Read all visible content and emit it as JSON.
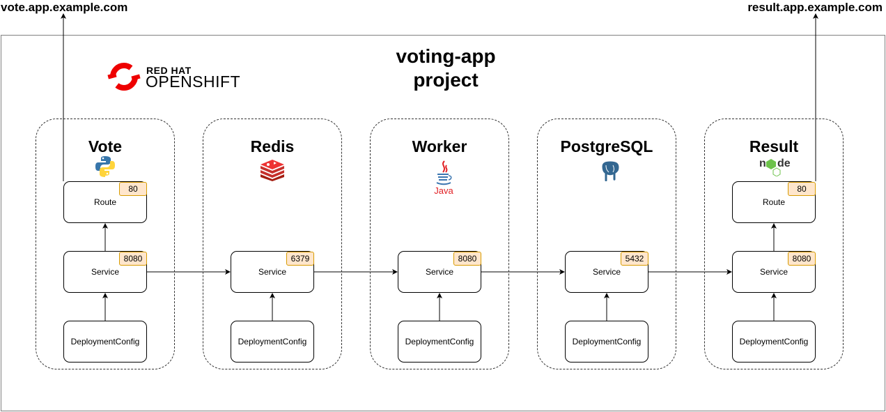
{
  "urls": {
    "vote": "vote.app.example.com",
    "result": "result.app.example.com"
  },
  "project_title": [
    "voting-app",
    "project"
  ],
  "logo": {
    "line1": "RED HAT",
    "line2": "OPENSHIFT",
    "color": "#ee0000"
  },
  "groups": [
    {
      "title": "Vote",
      "icon": "python-icon",
      "route": {
        "label": "Route",
        "port": "80"
      },
      "service": {
        "label": "Service",
        "port": "8080"
      },
      "deployment": "DeploymentConfig"
    },
    {
      "title": "Redis",
      "icon": "redis-icon",
      "service": {
        "label": "Service",
        "port": "6379"
      },
      "deployment": "DeploymentConfig"
    },
    {
      "title": "Worker",
      "icon": "java-icon",
      "service": {
        "label": "Service",
        "port": "8080"
      },
      "deployment": "DeploymentConfig"
    },
    {
      "title": "PostgreSQL",
      "icon": "postgresql-icon",
      "service": {
        "label": "Service",
        "port": "5432"
      },
      "deployment": "DeploymentConfig"
    },
    {
      "title": "Result",
      "icon": "nodejs-icon",
      "route": {
        "label": "Route",
        "port": "80"
      },
      "service": {
        "label": "Service",
        "port": "8080"
      },
      "deployment": "DeploymentConfig"
    }
  ],
  "colors": {
    "port_fill": "#ffe6cc",
    "port_border": "#d79b00"
  }
}
